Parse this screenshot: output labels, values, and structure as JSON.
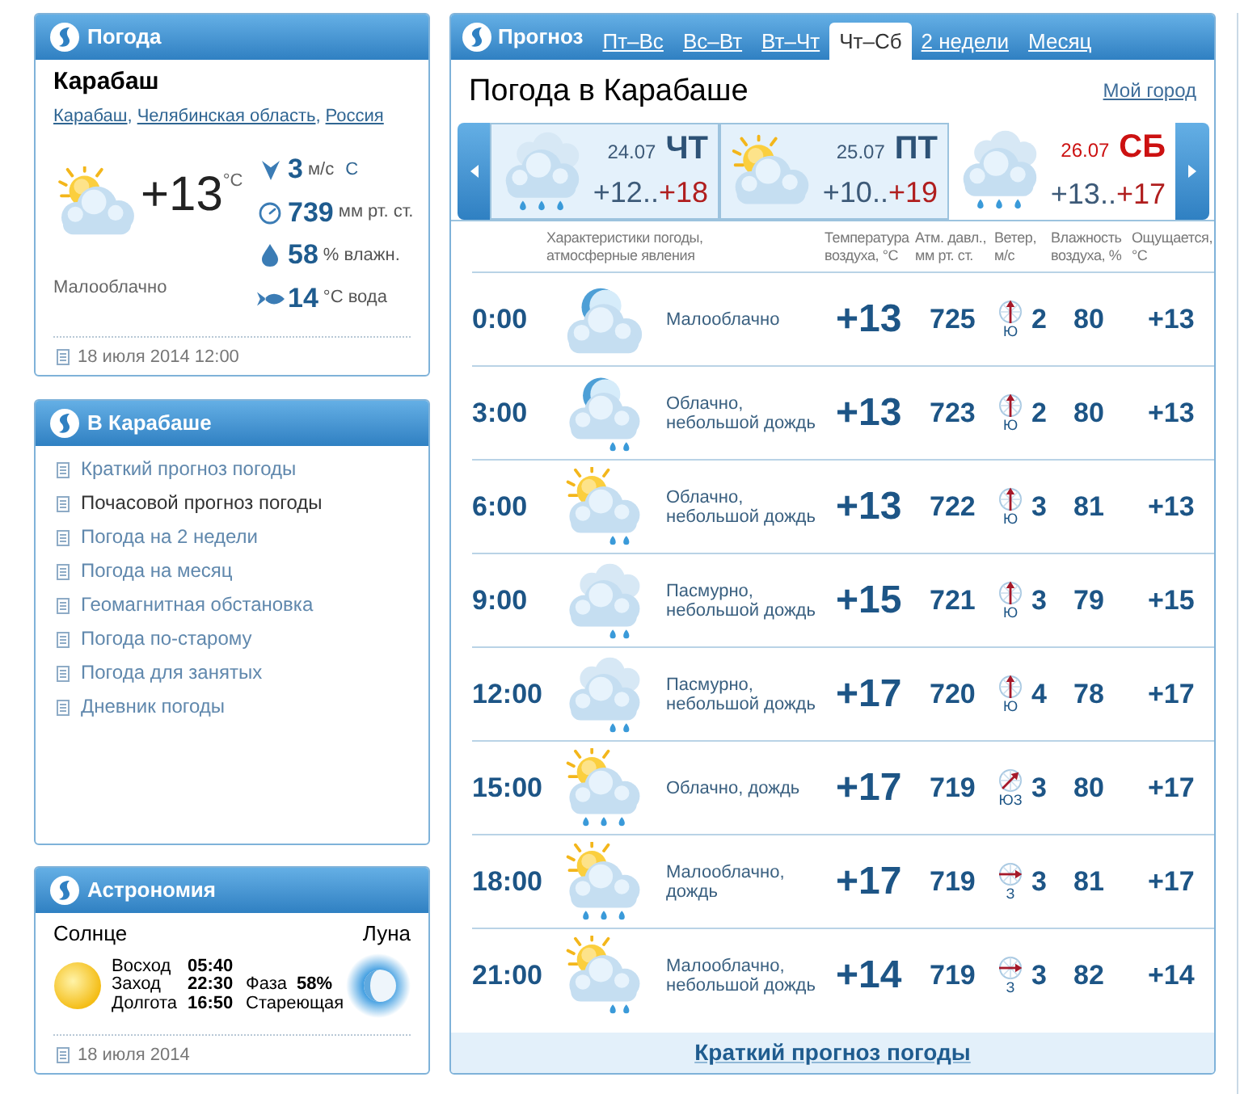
{
  "weather_panel": {
    "title": "Погода",
    "city": "Карабаш",
    "location_links": [
      {
        "label": "Карабаш",
        "trailing": ","
      },
      {
        "label": "Челябинская область",
        "trailing": ","
      },
      {
        "label": "Россия"
      }
    ],
    "kind": "sun-cloud",
    "temperature": "+13",
    "temperature_unit": "°C",
    "condition": "Малооблачно",
    "stats": [
      {
        "kind": "wind",
        "value": "3",
        "unit": "м/с",
        "direction": "С"
      },
      {
        "kind": "pressure",
        "value": "739",
        "unit": "мм рт. ст."
      },
      {
        "kind": "humidity",
        "value": "58",
        "unit": "% влажн."
      },
      {
        "kind": "water",
        "value": "14",
        "unit": "°C вода"
      }
    ],
    "updated": "18 июля 2014 12:00"
  },
  "city_panel": {
    "title": "В Карабаше",
    "items": [
      {
        "label": "Краткий прогноз погоды",
        "selected": false
      },
      {
        "label": "Почасовой прогноз погоды",
        "selected": true
      },
      {
        "label": "Погода на 2 недели",
        "selected": false
      },
      {
        "label": "Погода на месяц",
        "selected": false
      },
      {
        "label": "Геомагнитная обстановка",
        "selected": false
      },
      {
        "label": "Погода по-старому",
        "selected": false
      },
      {
        "label": "Погода для занятых",
        "selected": false
      },
      {
        "label": "Дневник погоды",
        "selected": false
      }
    ]
  },
  "astronomy_panel": {
    "title": "Астрономия",
    "sun_label": "Солнце",
    "moon_label": "Луна",
    "sun_rows": [
      {
        "label": "Восход",
        "value": "05:40"
      },
      {
        "label": "Заход",
        "value": "22:30"
      },
      {
        "label": "Долгота",
        "value": "16:50"
      }
    ],
    "phase_label": "Фаза",
    "phase_value": "58%",
    "phase_name": "Стареющая",
    "date": "18 июля 2014"
  },
  "forecast": {
    "title": "Прогноз",
    "tabs": [
      {
        "label": "Пт–Вс",
        "selected": false
      },
      {
        "label": "Вс–Вт",
        "selected": false
      },
      {
        "label": "Вт–Чт",
        "selected": false
      },
      {
        "label": "Чт–Сб",
        "selected": true
      },
      {
        "label": "2 недели",
        "selected": false
      },
      {
        "label": "Месяц",
        "selected": false
      }
    ],
    "heading": "Погода в Карабаше",
    "my_city_link": "Мой город",
    "days": [
      {
        "date": "24.07",
        "weekday": "ЧТ",
        "low": "+12..",
        "high": "+18",
        "kind": "overcast-rain",
        "weekend": false,
        "selected": false
      },
      {
        "date": "25.07",
        "weekday": "ПТ",
        "low": "+10..",
        "high": "+19",
        "kind": "sun-cloud",
        "weekend": false,
        "selected": false
      },
      {
        "date": "26.07",
        "weekday": "СБ",
        "low": "+13..",
        "high": "+17",
        "kind": "overcast-rain",
        "weekend": true,
        "selected": true
      }
    ],
    "columns": [
      "Характеристики погоды,\nатмосферные явления",
      "Температура\nвоздуха, °C",
      "Атм. давл.,\nмм рт. ст.",
      "Ветер,\nм/с",
      "Влажность\nвоздуха, %",
      "Ощущается,\n°C"
    ],
    "rows": [
      {
        "time": "0:00",
        "kind": "moon-cloud",
        "condition": "Малооблачно",
        "temperature": "+13",
        "pressure": "725",
        "wind": {
          "kind": "north",
          "direction": "Ю",
          "speed": "2"
        },
        "humidity": "80",
        "feels_like": "+13"
      },
      {
        "time": "3:00",
        "kind": "moon-drizzle",
        "condition": "Облачно,\nнебольшой дождь",
        "temperature": "+13",
        "pressure": "723",
        "wind": {
          "kind": "north",
          "direction": "Ю",
          "speed": "2"
        },
        "humidity": "80",
        "feels_like": "+13"
      },
      {
        "time": "6:00",
        "kind": "sun-drizzle",
        "condition": "Облачно,\nнебольшой дождь",
        "temperature": "+13",
        "pressure": "722",
        "wind": {
          "kind": "north",
          "direction": "Ю",
          "speed": "3"
        },
        "humidity": "81",
        "feels_like": "+13"
      },
      {
        "time": "9:00",
        "kind": "overcast-drizzle",
        "condition": "Пасмурно,\nнебольшой дождь",
        "temperature": "+15",
        "pressure": "721",
        "wind": {
          "kind": "north",
          "direction": "Ю",
          "speed": "3"
        },
        "humidity": "79",
        "feels_like": "+15"
      },
      {
        "time": "12:00",
        "kind": "overcast-drizzle",
        "condition": "Пасмурно,\nнебольшой дождь",
        "temperature": "+17",
        "pressure": "720",
        "wind": {
          "kind": "north",
          "direction": "Ю",
          "speed": "4"
        },
        "humidity": "78",
        "feels_like": "+17"
      },
      {
        "time": "15:00",
        "kind": "sun-rain",
        "condition": "Облачно, дождь",
        "temperature": "+17",
        "pressure": "719",
        "wind": {
          "kind": "northeast",
          "direction": "ЮЗ",
          "speed": "3"
        },
        "humidity": "80",
        "feels_like": "+17"
      },
      {
        "time": "18:00",
        "kind": "sun-rain",
        "condition": "Малооблачно,\nдождь",
        "temperature": "+17",
        "pressure": "719",
        "wind": {
          "kind": "east",
          "direction": "З",
          "speed": "3"
        },
        "humidity": "81",
        "feels_like": "+17"
      },
      {
        "time": "21:00",
        "kind": "sun-drizzle",
        "condition": "Малооблачно,\nнебольшой дождь",
        "temperature": "+14",
        "pressure": "719",
        "wind": {
          "kind": "east",
          "direction": "З",
          "speed": "3"
        },
        "humidity": "82",
        "feels_like": "+14"
      }
    ],
    "footer_link": "Краткий прогноз погоды"
  }
}
